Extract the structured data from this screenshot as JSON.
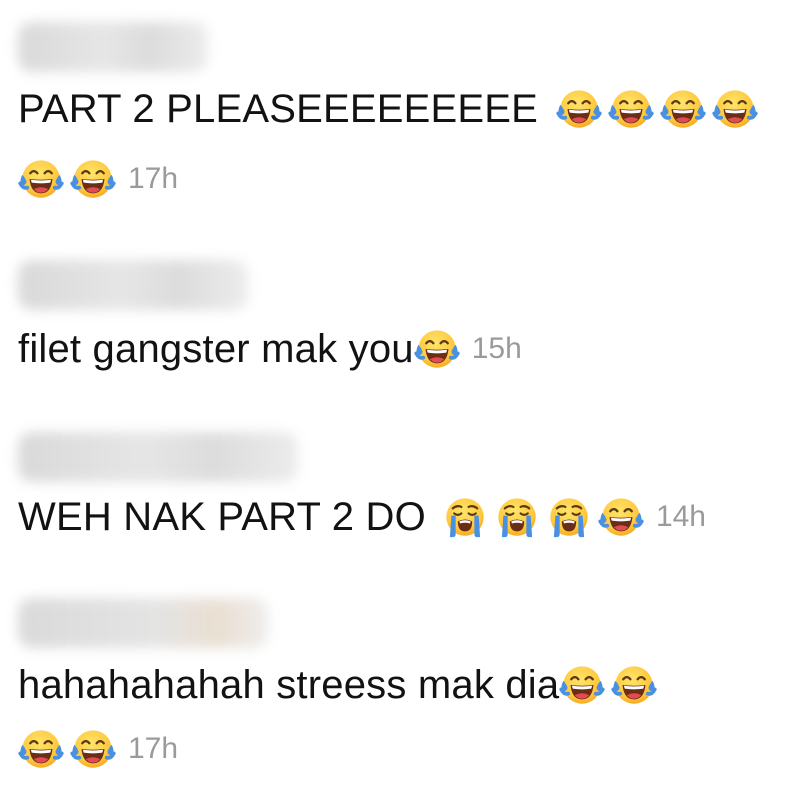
{
  "comments": [
    {
      "text": "PART 2 PLEASEEEEEEEEE",
      "time": "17h",
      "line1_emojis": [
        "laughing-tears",
        "laughing-tears",
        "laughing-tears",
        "laughing-tears"
      ],
      "line2_emojis": [
        "laughing-tears",
        "laughing-tears"
      ]
    },
    {
      "text": "filet gangster mak you",
      "time": "15h",
      "line1_emojis": [
        "laughing-tears"
      ]
    },
    {
      "text": "WEH NAK PART 2 DO",
      "time": "14h",
      "line1_emojis": [
        "loudly-crying",
        "loudly-crying",
        "loudly-crying",
        "laughing-tears"
      ]
    },
    {
      "text": "hahahahahah streess mak dia",
      "time": "17h",
      "line1_emojis": [
        "laughing-tears",
        "laughing-tears"
      ],
      "line2_emojis": [
        "laughing-tears",
        "laughing-tears"
      ]
    }
  ],
  "colors": {
    "text": "#121212",
    "timestamp": "#9a9a9a",
    "emoji_face": "#FFC83D",
    "emoji_tears": "#4A90E2"
  }
}
